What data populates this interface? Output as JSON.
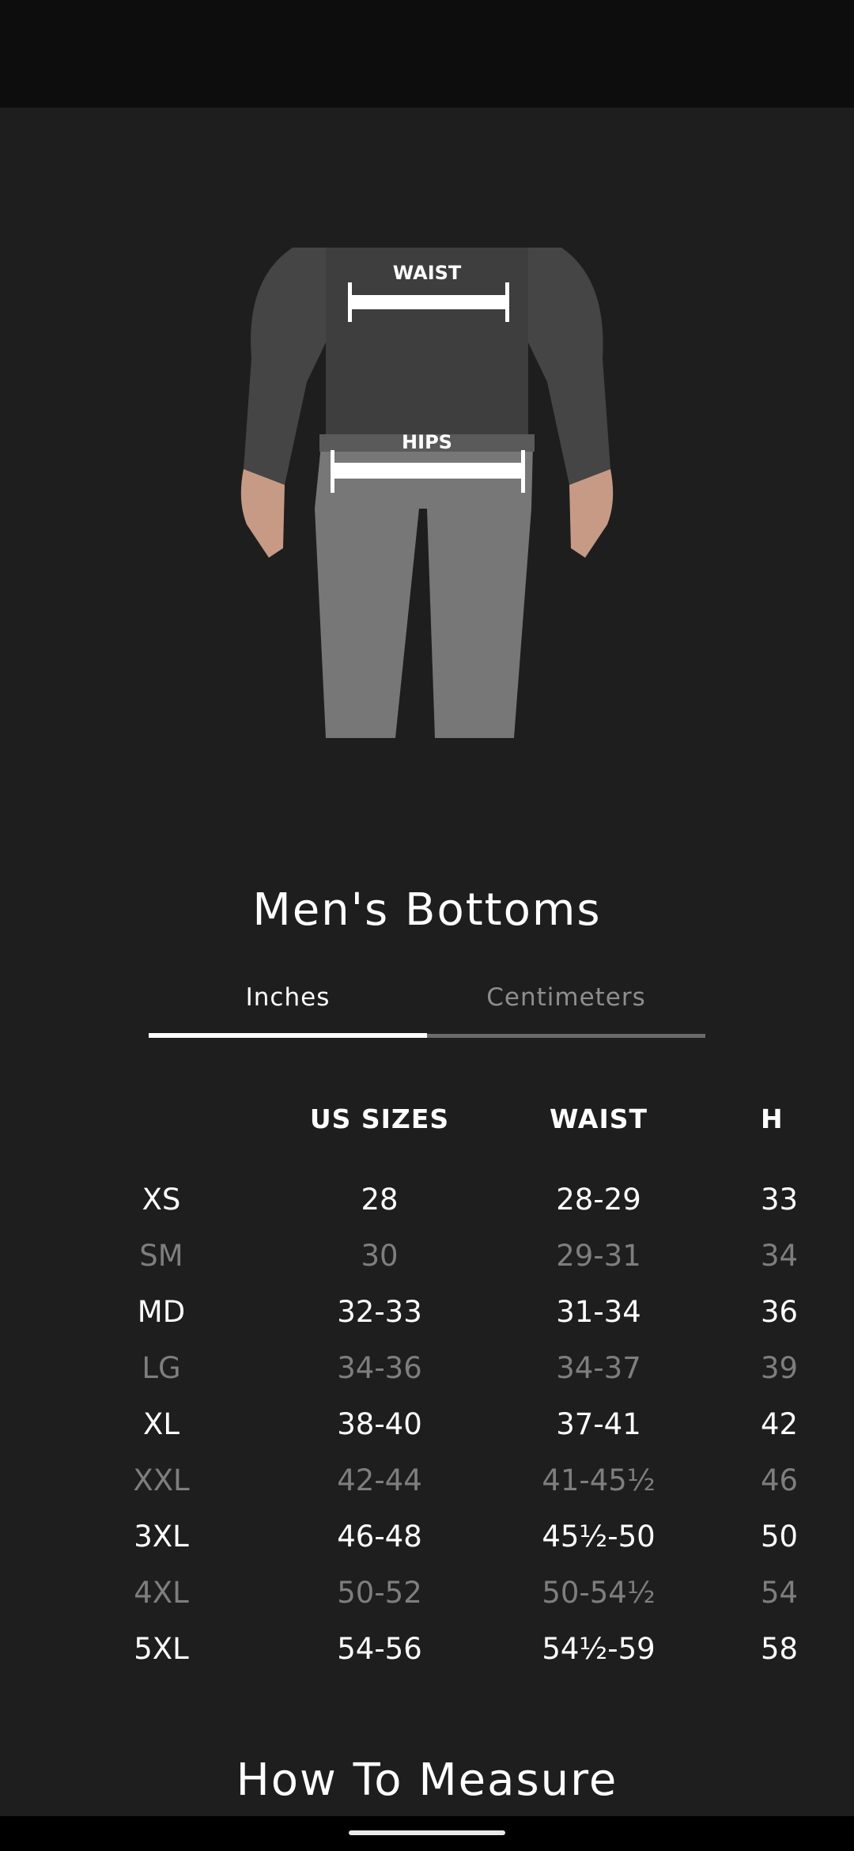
{
  "hero": {
    "labels": {
      "waist": "WAIST",
      "hips": "HIPS"
    }
  },
  "title": "Men's Bottoms",
  "unit_tabs": [
    {
      "label": "Inches",
      "active": true
    },
    {
      "label": "Centimeters",
      "active": false
    }
  ],
  "size_table": {
    "headers": [
      "",
      "US SIZES",
      "WAIST",
      "H"
    ],
    "rows": [
      {
        "size": "XS",
        "us": "28",
        "waist": "28-29",
        "hips": "33",
        "emphasis": "bright"
      },
      {
        "size": "SM",
        "us": "30",
        "waist": "29-31",
        "hips": "34",
        "emphasis": "dim"
      },
      {
        "size": "MD",
        "us": "32-33",
        "waist": "31-34",
        "hips": "36",
        "emphasis": "bright"
      },
      {
        "size": "LG",
        "us": "34-36",
        "waist": "34-37",
        "hips": "39",
        "emphasis": "dim"
      },
      {
        "size": "XL",
        "us": "38-40",
        "waist": "37-41",
        "hips": "42",
        "emphasis": "bright"
      },
      {
        "size": "XXL",
        "us": "42-44",
        "waist": "41-45½",
        "hips": "46",
        "emphasis": "dim"
      },
      {
        "size": "3XL",
        "us": "46-48",
        "waist": "45½-50",
        "hips": "50",
        "emphasis": "bright"
      },
      {
        "size": "4XL",
        "us": "50-52",
        "waist": "50-54½",
        "hips": "54",
        "emphasis": "dim"
      },
      {
        "size": "5XL",
        "us": "54-56",
        "waist": "54½-59",
        "hips": "58",
        "emphasis": "bright"
      }
    ]
  },
  "how_to_measure_title": "How To Measure",
  "colors": {
    "background": "#1e1e1e",
    "status_bar": "#0d0d0d",
    "text_bright": "#ffffff",
    "text_dim": "#7e7e7e",
    "tab_inactive_line": "#6a6a6a"
  }
}
